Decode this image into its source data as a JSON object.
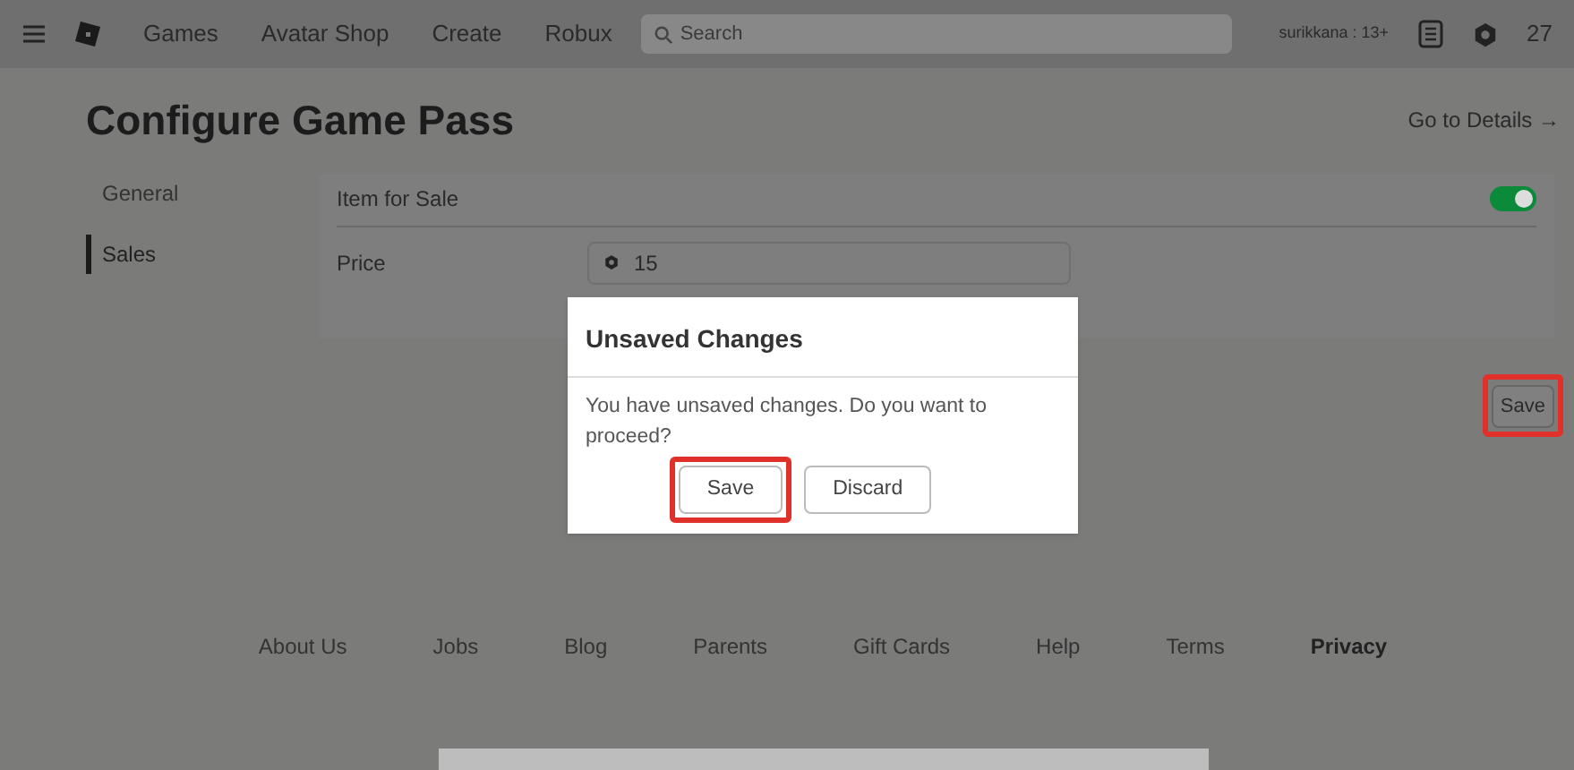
{
  "nav": {
    "items": [
      "Games",
      "Avatar Shop",
      "Create",
      "Robux"
    ],
    "search": {
      "placeholder": "Search"
    },
    "username": "surikkana : 13+",
    "robux": "27"
  },
  "page": {
    "title": "Configure Game Pass",
    "details_link": "Go to Details →"
  },
  "sidebar": {
    "items": [
      {
        "label": "General",
        "selected": false
      },
      {
        "label": "Sales",
        "selected": true
      }
    ]
  },
  "sales": {
    "item_for_sale": {
      "label": "Item for Sale",
      "on": true
    },
    "price": {
      "label": "Price",
      "value": "15"
    },
    "save": {
      "label": "Save",
      "highlighted": true
    }
  },
  "dialog": {
    "title": "Unsaved Changes",
    "message": "You have unsaved changes. Do you want to proceed?",
    "buttons": [
      {
        "label": "Save",
        "highlighted": true
      },
      {
        "label": "Discard",
        "highlighted": false
      }
    ]
  },
  "footer": {
    "links": [
      {
        "label": "About Us",
        "bold": false
      },
      {
        "label": "Jobs",
        "bold": false
      },
      {
        "label": "Blog",
        "bold": false
      },
      {
        "label": "Parents",
        "bold": false
      },
      {
        "label": "Gift Cards",
        "bold": false
      },
      {
        "label": "Help",
        "bold": false
      },
      {
        "label": "Terms",
        "bold": false
      },
      {
        "label": "Privacy",
        "bold": true
      }
    ]
  }
}
